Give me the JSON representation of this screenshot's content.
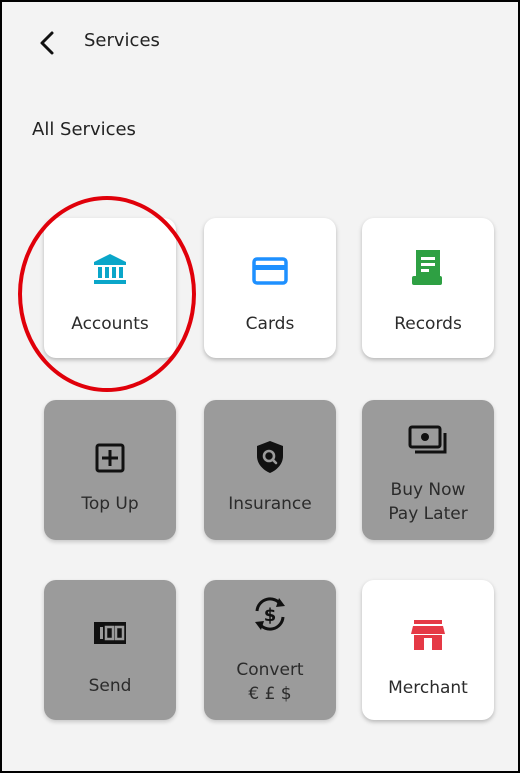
{
  "header": {
    "title": "Services"
  },
  "section": {
    "title": "All Services"
  },
  "tiles": [
    {
      "label": "Accounts"
    },
    {
      "label": "Cards"
    },
    {
      "label": "Records"
    },
    {
      "label": "Top Up"
    },
    {
      "label": "Insurance"
    },
    {
      "label_line1": "Buy Now",
      "label_line2": "Pay Later"
    },
    {
      "label": "Send"
    },
    {
      "label_line1": "Convert",
      "label_line2": "€ £ $"
    },
    {
      "label": "Merchant"
    }
  ],
  "colors": {
    "accounts_icon": "#0aa6c9",
    "cards_icon": "#1e90ff",
    "records_icon": "#2ea043",
    "merchant_icon": "#e53945",
    "disabled_tile": "#9b9b9b",
    "highlight": "#e0000a"
  }
}
